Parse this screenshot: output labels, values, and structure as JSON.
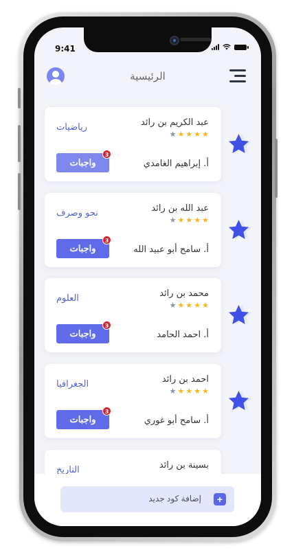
{
  "status_bar": {
    "time": "9:41"
  },
  "header": {
    "title": "الرئيسية"
  },
  "cards": [
    {
      "student": "عبد الكريم بن رائد",
      "subject": "رياضيات",
      "teacher": "أ. إبراهيم الغامدي",
      "homework_label": "واجبات",
      "badge": "3",
      "rating": 4
    },
    {
      "student": "عبد الله بن رائد",
      "subject": "نحو وصرف",
      "teacher": "أ. سامح أبو عبيد الله",
      "homework_label": "واجبات",
      "badge": "3",
      "rating": 4
    },
    {
      "student": "محمد بن رائد",
      "subject": "العلوم",
      "teacher": "أ. احمد الحامد",
      "homework_label": "واجبات",
      "badge": "3",
      "rating": 4
    },
    {
      "student": "احمد بن رائد",
      "subject": "الجغرافيا",
      "teacher": "أ. سامح أبو غوري",
      "homework_label": "واجبات",
      "badge": "3",
      "rating": 4
    },
    {
      "student": "بسينة بن رائد",
      "subject": "التاريخ"
    }
  ],
  "bottom": {
    "add_code_label": "إضافة كود جديد"
  },
  "colors": {
    "accent": "#5f6be8",
    "star_gold": "#f5b81c",
    "star_grey": "#8a96a8",
    "badge_red": "#d6232c",
    "background": "#f3f4f9"
  }
}
